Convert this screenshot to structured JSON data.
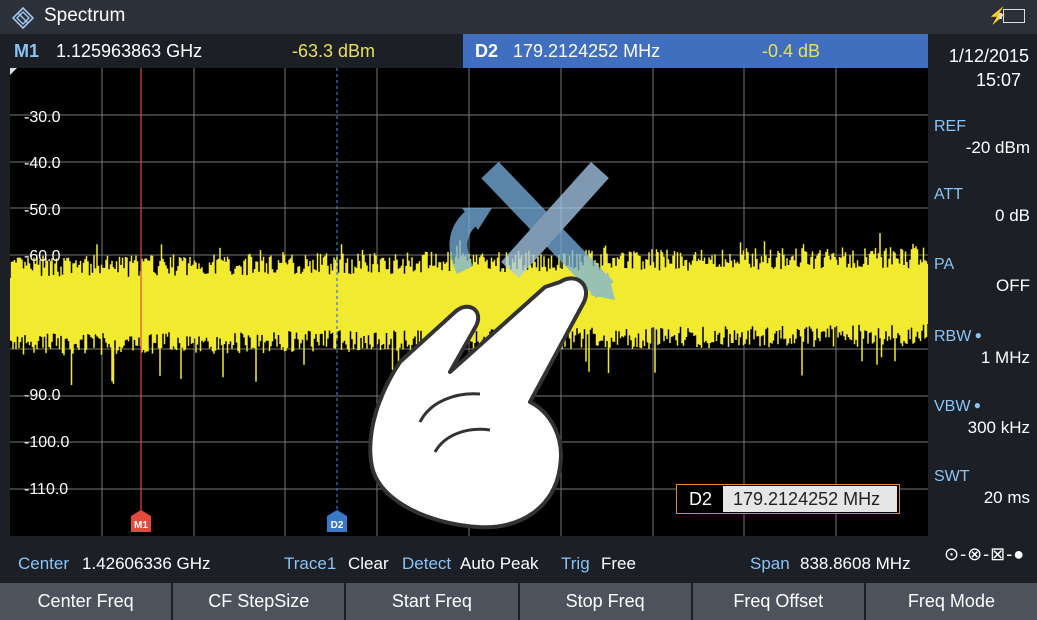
{
  "app": {
    "title": "Spectrum",
    "logo_icon": "rohde-schwarz-diamond-icon"
  },
  "status_icons": {
    "power": "bolt-icon",
    "battery": "battery-icon"
  },
  "marker1": {
    "label": "M1",
    "frequency": "1.125963863 GHz",
    "level": "-63.3 dBm"
  },
  "delta2": {
    "label": "D2",
    "frequency": "179.2124252 MHz",
    "level": "-0.4 dB"
  },
  "datetime": {
    "date": "1/12/2015",
    "time": "15:07"
  },
  "params": [
    {
      "label": "REF",
      "value": "-20 dBm",
      "dot": false
    },
    {
      "label": "ATT",
      "value": "0 dB",
      "dot": false
    },
    {
      "label": "PA",
      "value": "OFF",
      "dot": false
    },
    {
      "label": "RBW",
      "value": "1 MHz",
      "dot": true
    },
    {
      "label": "VBW",
      "value": "300 kHz",
      "dot": true
    },
    {
      "label": "SWT",
      "value": "20 ms",
      "dot": false
    }
  ],
  "connection_symbol": "⊙-⊗-⊠-●",
  "plot": {
    "y_ticks": [
      "-30.0",
      "-40.0",
      "-50.0",
      "-60.0",
      "-90.0",
      "-100.0",
      "-110.0"
    ],
    "marker_m1_label": "M1",
    "marker_d2_label": "D2",
    "trace_color": "#f2ea2e",
    "m1_color": "#e24a3b",
    "d2_color": "#3a78c8"
  },
  "status": {
    "center_label": "Center",
    "center_value": "1.42606336 GHz",
    "trace_label": "Trace1",
    "trace_value": "Clear",
    "detect_label": "Detect",
    "detect_value": "Auto Peak",
    "trig_label": "Trig",
    "trig_value": "Free",
    "span_label": "Span",
    "span_value": "838.8608 MHz"
  },
  "d2_entry": {
    "label": "D2",
    "value": "179.2124252 MHz"
  },
  "softkeys": [
    "Center Freq",
    "CF StepSize",
    "Start Freq",
    "Stop Freq",
    "Freq Offset",
    "Freq Mode"
  ],
  "overlay": {
    "gesture_icon": "pinch-rotate-hand-icon",
    "arrows_icon": "cross-arrows-icon"
  }
}
